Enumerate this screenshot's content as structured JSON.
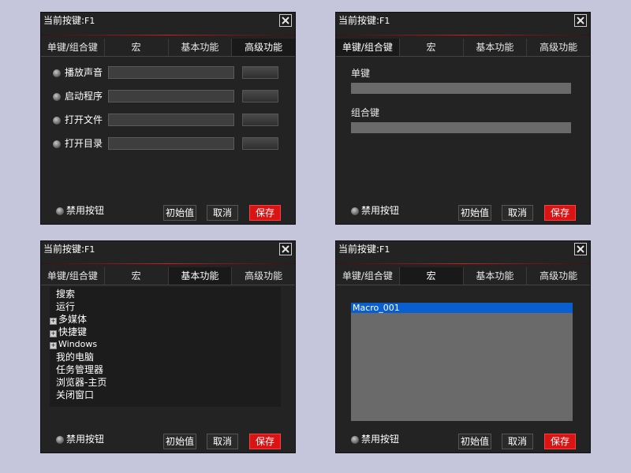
{
  "title_prefix": "当前按键:",
  "title_key": "F1",
  "tabs": [
    "单键/组合键",
    "宏",
    "基本功能",
    "高级功能"
  ],
  "bottom": {
    "disable_label": "禁用按钮",
    "init_label": "初始值",
    "cancel_label": "取消",
    "save_label": "保存"
  },
  "advanced": {
    "items": [
      "播放声音",
      "启动程序",
      "打开文件",
      "打开目录"
    ]
  },
  "single": {
    "single_label": "单键",
    "combo_label": "组合键"
  },
  "basic": {
    "tree": [
      {
        "label": "搜索",
        "expandable": false
      },
      {
        "label": "运行",
        "expandable": false
      },
      {
        "label": "多媒体",
        "expandable": true
      },
      {
        "label": "快捷键",
        "expandable": true
      },
      {
        "label": "Windows",
        "expandable": true
      },
      {
        "label": "我的电脑",
        "expandable": false
      },
      {
        "label": "任务管理器",
        "expandable": false
      },
      {
        "label": "浏览器-主页",
        "expandable": false
      },
      {
        "label": "关闭窗口",
        "expandable": false
      }
    ]
  },
  "macro": {
    "items": [
      "Macro_001"
    ]
  },
  "colors": {
    "background": "#c5c6dc",
    "panel": "#232323",
    "save_button": "#d81414",
    "selection": "#0a5fd0",
    "accent_line": "#d02020"
  },
  "icons": {
    "close": "close-icon",
    "radio": "radio-icon",
    "expand": "expand-plus-icon"
  }
}
